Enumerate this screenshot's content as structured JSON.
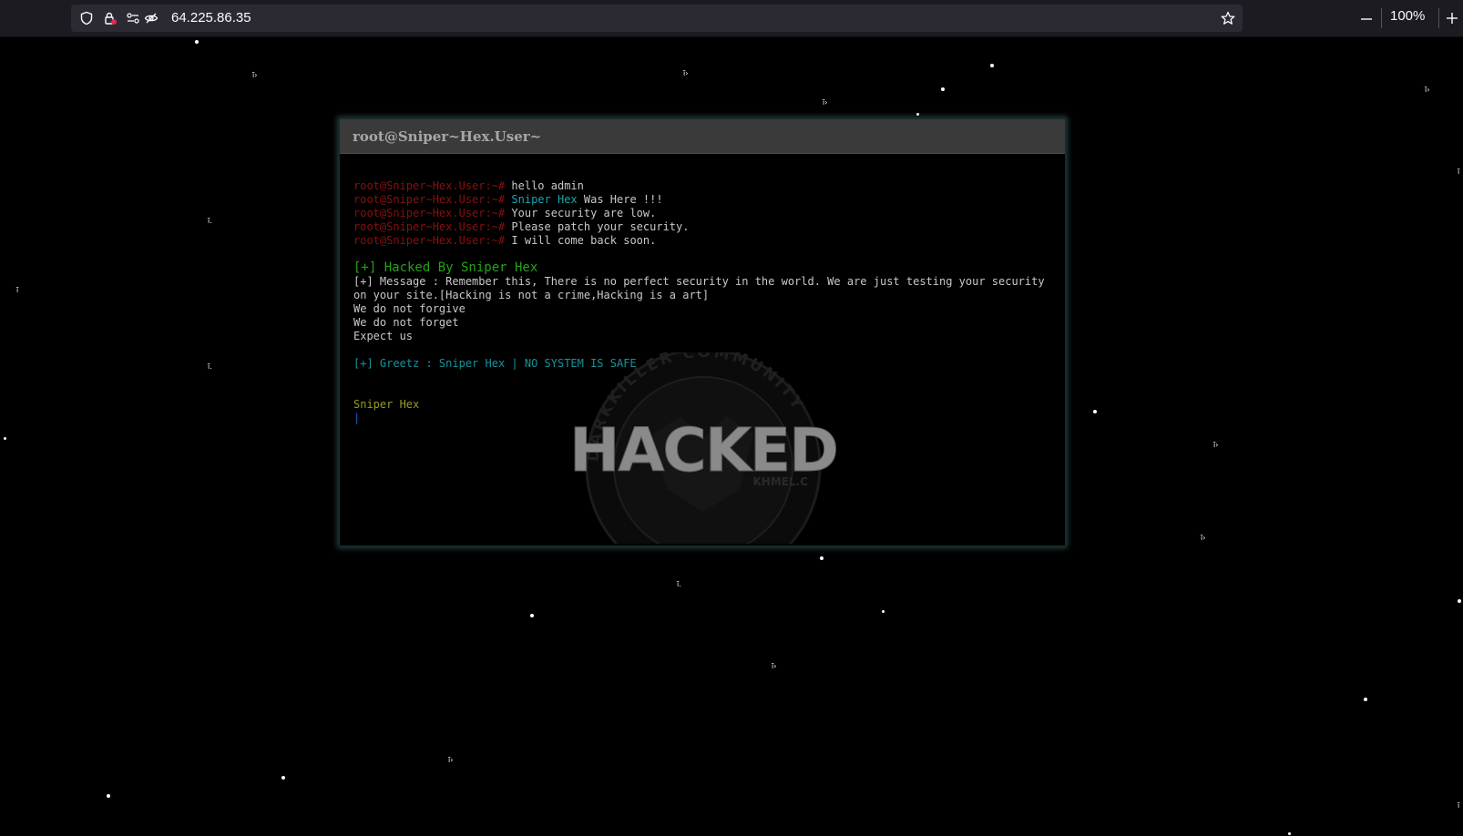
{
  "browser": {
    "url": "64.225.86.35",
    "zoom": "100%",
    "zoom_out_icon": "minus-icon",
    "zoom_in_icon": "plus-icon",
    "bookmark_icon": "star-icon"
  },
  "terminal": {
    "title": "root@Sniper~Hex.User~",
    "prompt": "root@Sniper~Hex.User:~#",
    "commands": [
      {
        "text": "hello admin"
      },
      {
        "highlight": "Sniper Hex",
        "text": " Was Here !!!"
      },
      {
        "text": "Your security are low."
      },
      {
        "text": "Please patch your security."
      },
      {
        "text": "I will come back soon."
      }
    ],
    "hacked_by": "[+] Hacked By Sniper Hex",
    "message": "[+] Message : Remember this, There is no perfect security in the world. We are just testing your security on your site.[Hacking is not a crime,Hacking is a art]",
    "slogans": [
      "We do not forgive",
      "We do not forget",
      "Expect us"
    ],
    "greetz": "[+] Greetz : Sniper Hex | NO SYSTEM IS SAFE",
    "signature": "Sniper Hex",
    "cursor": "|"
  },
  "logo": {
    "ring_text": "DARKKILLER COMMUNITY",
    "main_text": "HACKED",
    "sub_text": "KHMEL.C"
  },
  "colors": {
    "prompt": "#8b0f0f",
    "highlight": "#1aa6b0",
    "hacked_by": "#27a11a",
    "signature": "#9a9a20"
  }
}
